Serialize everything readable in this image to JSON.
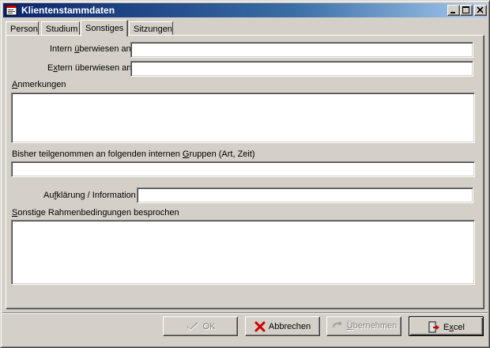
{
  "window": {
    "title": "Klientenstammdaten"
  },
  "tabs": [
    {
      "label": "Person",
      "active": false
    },
    {
      "label": "Studium",
      "active": false
    },
    {
      "label": "Sonstiges",
      "active": true
    },
    {
      "label": "Sitzungen",
      "active": false
    }
  ],
  "form": {
    "intern_label_pre": "Intern ",
    "intern_label_acc": "ü",
    "intern_label_post": "berwiesen an",
    "intern_value": "",
    "extern_label_pre": "E",
    "extern_label_acc": "x",
    "extern_label_post": "tern überwiesen an",
    "extern_value": "",
    "anmerkungen_label_acc": "A",
    "anmerkungen_label_post": "nmerkungen",
    "anmerkungen_value": "",
    "gruppen_label_pre": "Bisher teilgenommen an folgenden internen ",
    "gruppen_label_acc": "G",
    "gruppen_label_post": "ruppen (Art, Zeit)",
    "gruppen_value": "",
    "aufklaerung_label_pre": "Au",
    "aufklaerung_label_acc": "f",
    "aufklaerung_label_post": "klärung / Information",
    "aufklaerung_value": "",
    "rahmen_label_acc": "S",
    "rahmen_label_post": "onstige Rahmenbedingungen besprochen",
    "rahmen_value": ""
  },
  "buttons": {
    "ok_label": "OK",
    "cancel_label": "Abbrechen",
    "apply_label_acc": "Ü",
    "apply_label_post": "bernehmen",
    "excel_label_pre": "E",
    "excel_label_acc": "x",
    "excel_label_post": "cel"
  },
  "icons": {
    "app": "app-window-icon",
    "ok": "checkmark-icon",
    "cancel": "red-x-icon",
    "apply": "apply-arrow-icon",
    "excel": "export-door-icon"
  },
  "colors": {
    "title_start": "#0a246a",
    "title_end": "#a6caf0",
    "face": "#d4d0c8",
    "cancel_red": "#cc0000"
  }
}
